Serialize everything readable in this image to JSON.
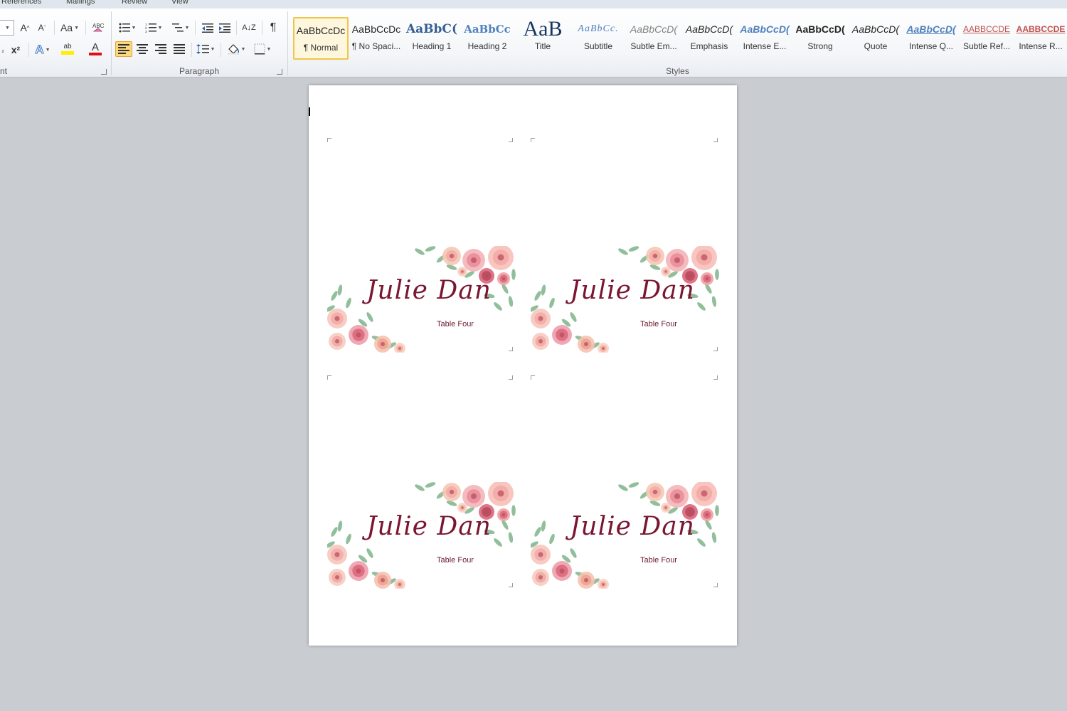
{
  "ribbon": {
    "tabs": [
      "References",
      "Mailings",
      "Review",
      "View"
    ],
    "groups": {
      "font_label": "nt",
      "paragraph_label": "Paragraph",
      "styles_label": "Styles"
    },
    "font_tools": {
      "grow_glyph": "A",
      "shrink_glyph": "A",
      "change_case_glyph": "Aa",
      "superscript_glyph": "x²",
      "text_effects_glyph": "A",
      "highlight_glyph": "ab",
      "font_color_glyph": "A",
      "font_color": "#e01010",
      "highlight_color": "#ffef00"
    },
    "paragraph_tools": {
      "show_marks_glyph": "¶",
      "sort_glyph": "A↓Z"
    },
    "styles": [
      {
        "sample": "AaBbCcDc",
        "name": "¶ Normal",
        "selected": true
      },
      {
        "sample": "AaBbCcDc",
        "name": "¶ No Spaci..."
      },
      {
        "sample": "AaBbC(",
        "name": "Heading 1"
      },
      {
        "sample": "AaBbCc",
        "name": "Heading 2"
      },
      {
        "sample": "AaB",
        "name": "Title"
      },
      {
        "sample": "AaBbCc.",
        "name": "Subtitle"
      },
      {
        "sample": "AaBbCcD(",
        "name": "Subtle Em..."
      },
      {
        "sample": "AaBbCcD(",
        "name": "Emphasis"
      },
      {
        "sample": "AaBbCcD(",
        "name": "Intense E..."
      },
      {
        "sample": "AaBbCcD(",
        "name": "Strong"
      },
      {
        "sample": "AaBbCcD(",
        "name": "Quote"
      },
      {
        "sample": "AaBbCcD(",
        "name": "Intense Q..."
      },
      {
        "sample": "AABBCCDE",
        "name": "Subtle Ref..."
      },
      {
        "sample": "AABBCCDE",
        "name": "Intense R..."
      }
    ]
  },
  "document": {
    "cards": [
      {
        "name": "Julie Dan",
        "table": "Table Four"
      },
      {
        "name": "Julie Dan",
        "table": "Table Four"
      },
      {
        "name": "Julie Dan",
        "table": "Table Four"
      },
      {
        "name": "Julie Dan",
        "table": "Table Four"
      }
    ],
    "colors": {
      "name_color": "#7a1632",
      "flower_pink": "#f2a9a7",
      "flower_rose": "#d9667a",
      "leaf_green": "#7fb48a"
    }
  }
}
